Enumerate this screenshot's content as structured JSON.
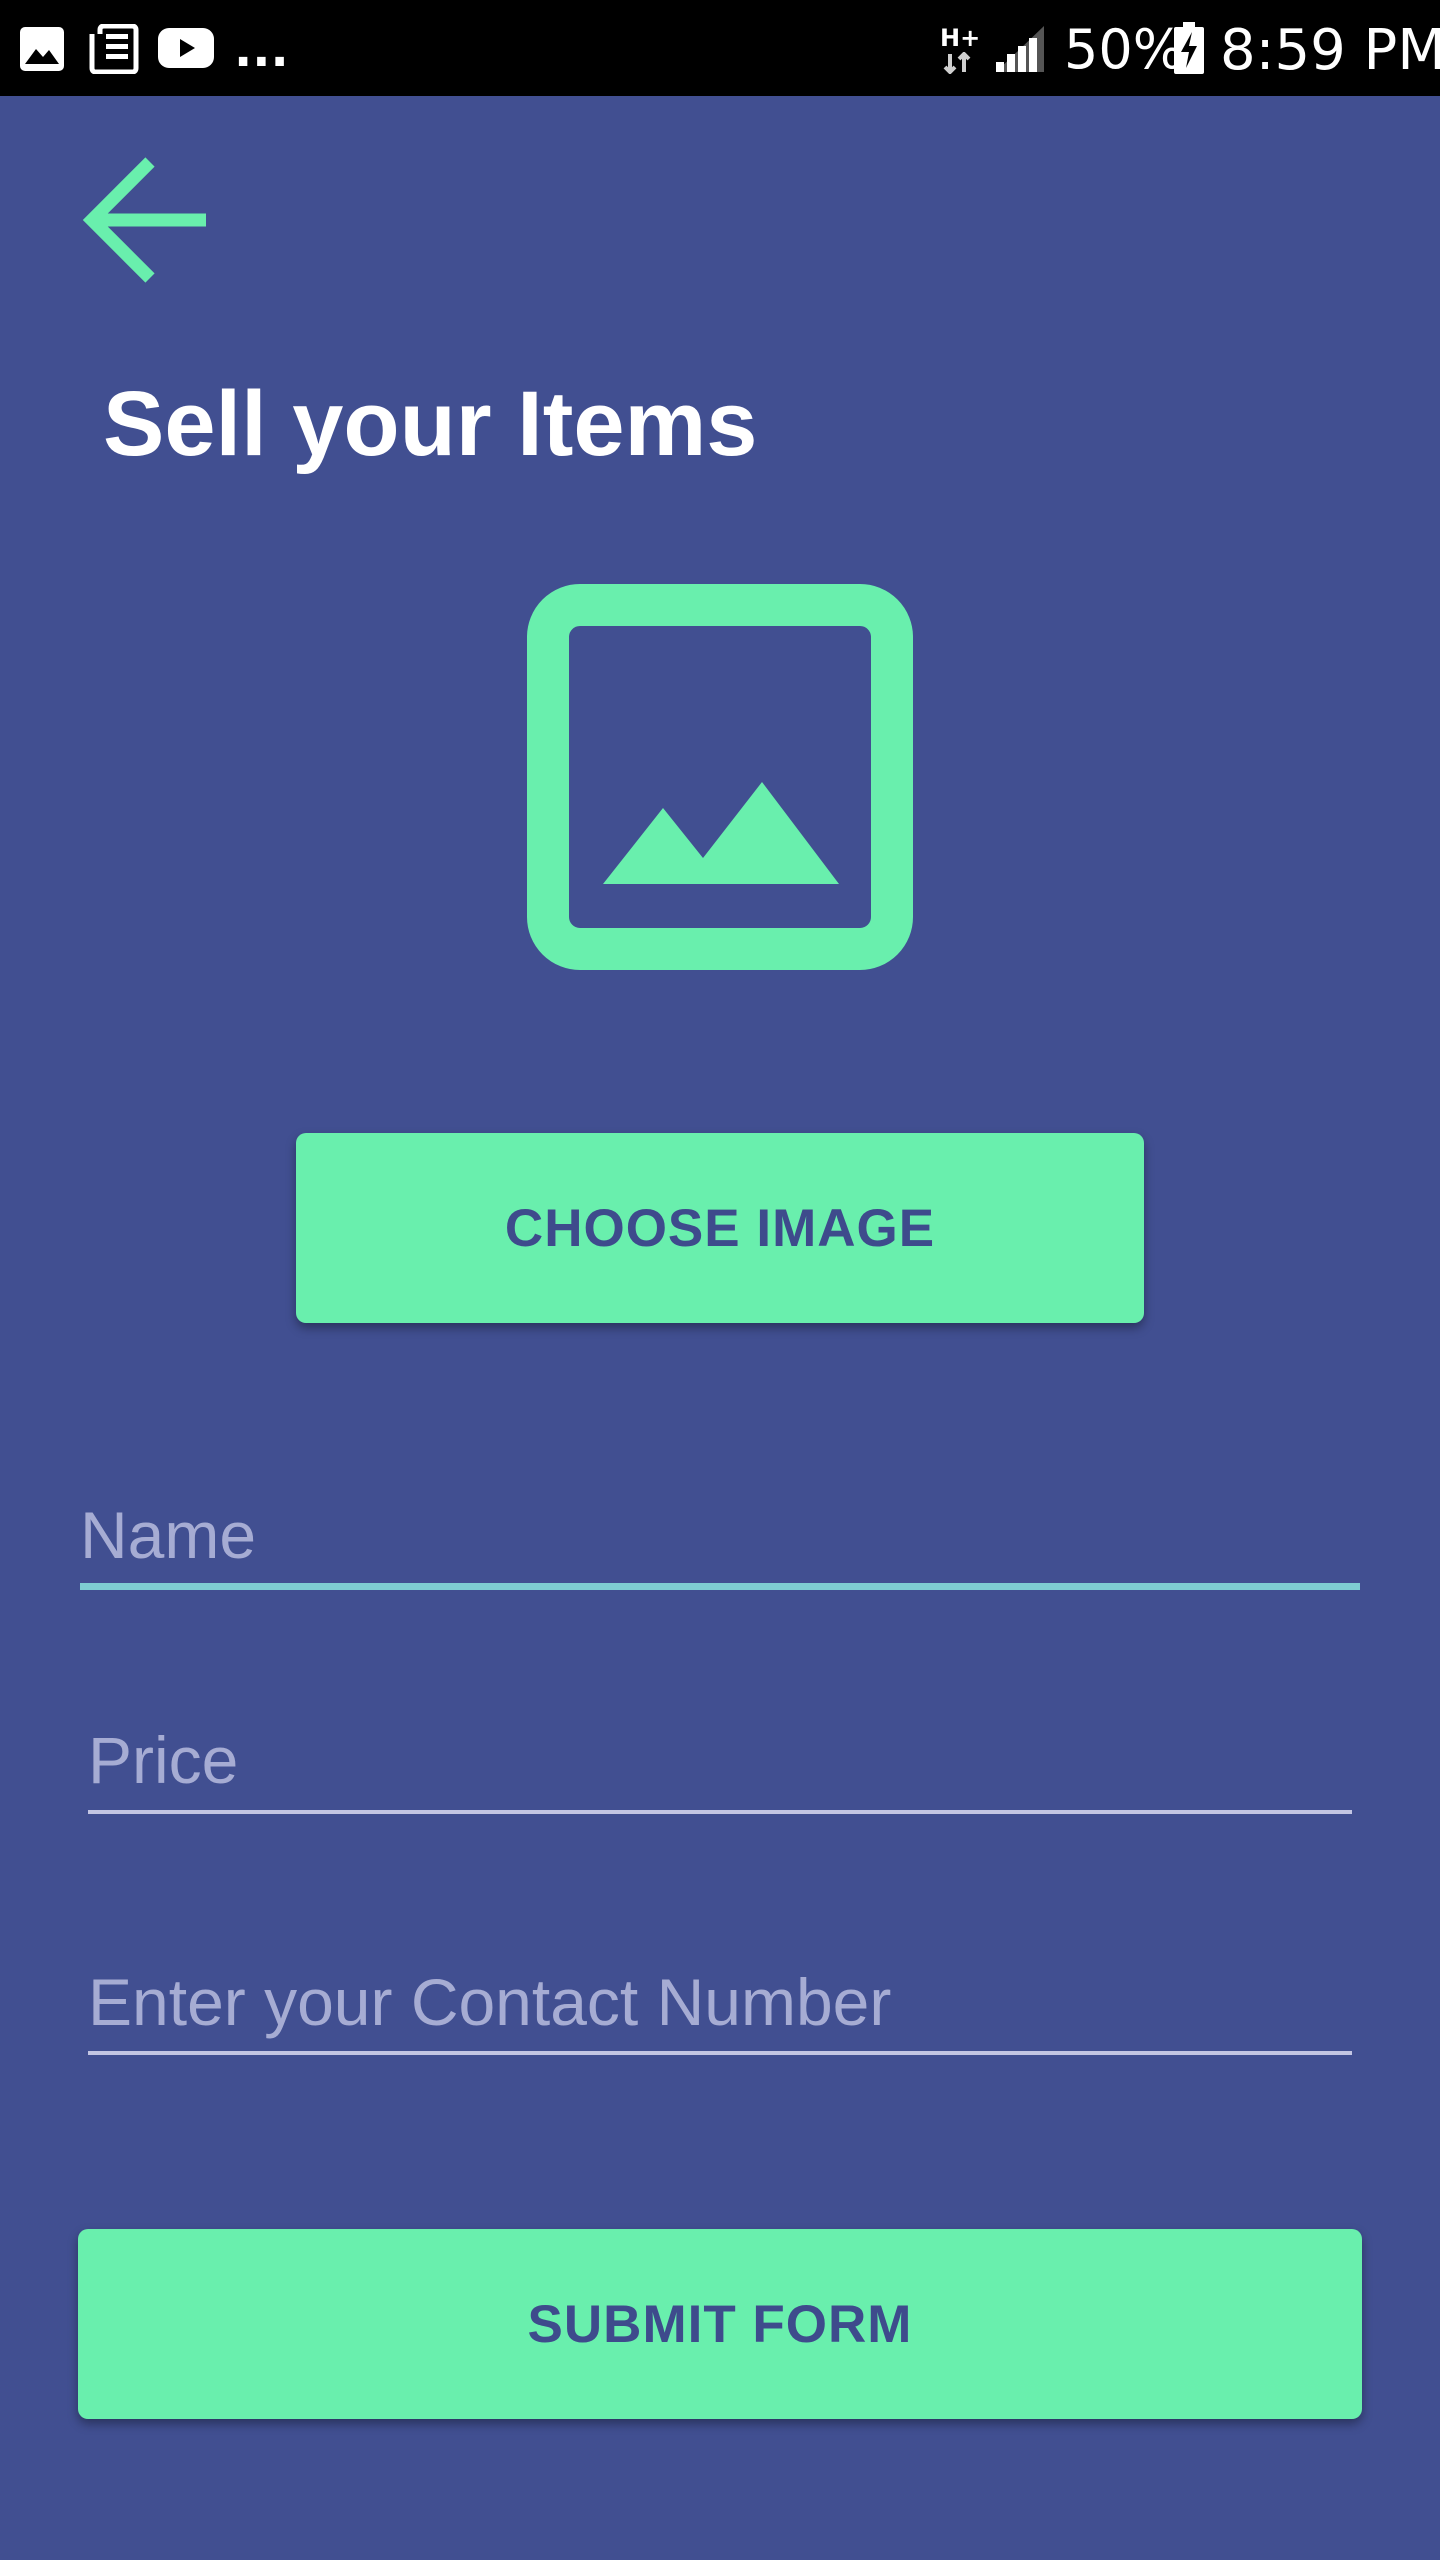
{
  "status_bar": {
    "notification_icons": [
      "image-icon",
      "news-icon",
      "youtube-icon"
    ],
    "more_indicator": "...",
    "network_type": "H+",
    "battery_percent": "50%",
    "time": "8:59 PM"
  },
  "header": {
    "back_icon": "arrow-left-icon",
    "title": "Sell your Items"
  },
  "image_picker": {
    "preview_icon": "image-placeholder-icon",
    "choose_label": "CHOOSE IMAGE"
  },
  "form": {
    "name_placeholder": "Name",
    "price_placeholder": "Price",
    "contact_placeholder": "Enter your Contact Number",
    "submit_label": "SUBMIT FORM"
  },
  "colors": {
    "background": "#414f91",
    "accent": "#69efad",
    "button_text": "#3e4b8c",
    "placeholder": "#a6acd3",
    "focused_underline": "#7ecdd2",
    "status_bar": "#000000"
  }
}
